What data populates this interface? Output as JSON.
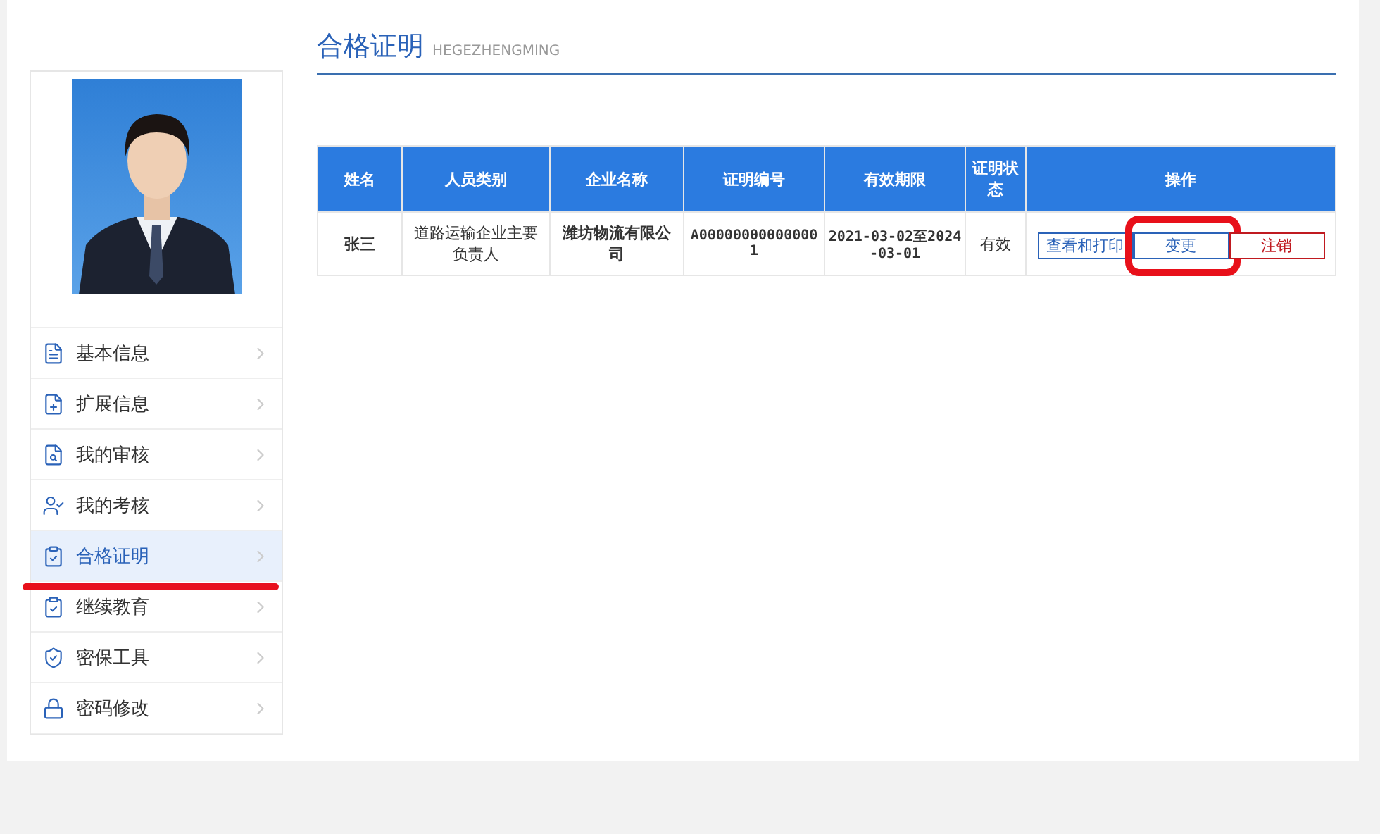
{
  "page": {
    "title": "合格证明",
    "subtitle": "HEGEZHENGMING"
  },
  "sidebar": {
    "items": [
      {
        "label": "基本信息",
        "kind": "doc",
        "selected": false,
        "marked": false
      },
      {
        "label": "扩展信息",
        "kind": "docplus",
        "selected": false,
        "marked": false
      },
      {
        "label": "我的审核",
        "kind": "docsearch",
        "selected": false,
        "marked": false
      },
      {
        "label": "我的考核",
        "kind": "user",
        "selected": false,
        "marked": false
      },
      {
        "label": "合格证明",
        "kind": "cert",
        "selected": true,
        "marked": true
      },
      {
        "label": "继续教育",
        "kind": "cert",
        "selected": false,
        "marked": false
      },
      {
        "label": "密保工具",
        "kind": "shield",
        "selected": false,
        "marked": false
      },
      {
        "label": "密码修改",
        "kind": "lock",
        "selected": false,
        "marked": false
      }
    ]
  },
  "table": {
    "columns": [
      "姓名",
      "人员类别",
      "企业名称",
      "证明编号",
      "有效期限",
      "证明状态",
      "操作"
    ],
    "rows": [
      {
        "name": "张三",
        "category": "道路运输企业主要负责人",
        "company": "潍坊物流有限公司",
        "number": "A000000000000001",
        "validity": "2021-03-02至2024-03-01",
        "status": "有效",
        "actions": [
          {
            "label": "查看和打印",
            "kind": "view",
            "marked": false
          },
          {
            "label": "变更",
            "kind": "change",
            "marked": true
          },
          {
            "label": "注销",
            "kind": "cancel",
            "marked": false
          }
        ]
      }
    ]
  }
}
